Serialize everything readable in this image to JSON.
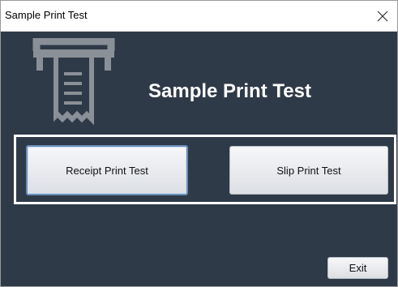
{
  "window": {
    "title": "Sample Print Test"
  },
  "main": {
    "heading": "Sample Print Test",
    "icon": "receipt-printer-icon"
  },
  "buttons": {
    "receipt_label": "Receipt Print Test",
    "slip_label": "Slip Print Test",
    "exit_label": "Exit"
  },
  "colors": {
    "background": "#2f3a48",
    "icon": "#8a9097",
    "heading": "#ffffff",
    "focus_border": "#6a8fb8"
  }
}
